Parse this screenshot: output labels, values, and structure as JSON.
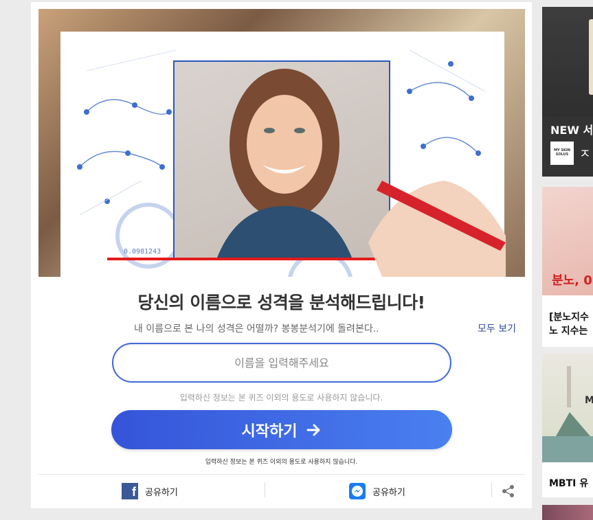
{
  "quiz": {
    "title": "당신의 이름으로 성격을 분석해드립니다!",
    "subtitle": "내 이름으로 본 나의 성격은 어떨까? 봉봉분석기에 돌려본다..",
    "view_all": "모두 보기",
    "name_placeholder": "이름을 입력해주세요",
    "privacy_notice": "입력하신 정보는 본 퀴즈 이외의 용도로 사용하지 않습니다.",
    "start_label": "시작하기",
    "hero_number": "0.0981243"
  },
  "share": {
    "facebook_label": "공유하기",
    "messenger_label": "공유하기"
  },
  "sidebar": {
    "item1_title": "NEW 서",
    "item1_logo": "MY SKIN SOLUS",
    "item1_extra": "ㅈ",
    "item2_image_text": "분노, 0",
    "item2_text_line1": "[분노지수",
    "item2_text_line2": "노 지수는",
    "item3_image_text": "M",
    "item3_text": "MBTI 유"
  },
  "colors": {
    "accent": "#3a5ee0",
    "facebook": "#3b5998",
    "messenger": "#1a7cf4"
  }
}
